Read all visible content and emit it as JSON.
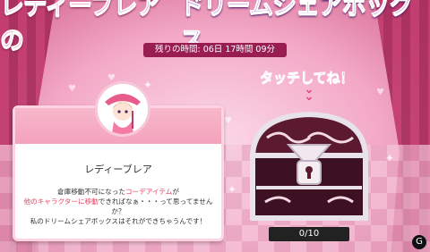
{
  "title": {
    "part1": "レディーブレアの",
    "part2": "ドリームシェアボックス"
  },
  "timer": {
    "label": "残りの時間: 06日 17時間 09分"
  },
  "card": {
    "name": "レディーブレア",
    "desc_line1_a": "倉庫移動不可になった",
    "desc_line1_b": "コーデアイテム",
    "desc_line1_c": "が",
    "desc_line2_a": "他のキャラクターに移動",
    "desc_line2_b": "できればなぁ・・・って思ってませんか？",
    "desc_line3": "私のドリームシェアボックスはそれができちゃうんです！"
  },
  "touch_prompt": "タッチしてね！",
  "counter": "0/10",
  "colors": {
    "pink": "#e52b6f",
    "purple": "#8a2cc4",
    "timer_bg": "#9a1d52"
  },
  "icons": {
    "chevron": "double-chevron-down-icon",
    "box": "treasure-box-icon"
  }
}
